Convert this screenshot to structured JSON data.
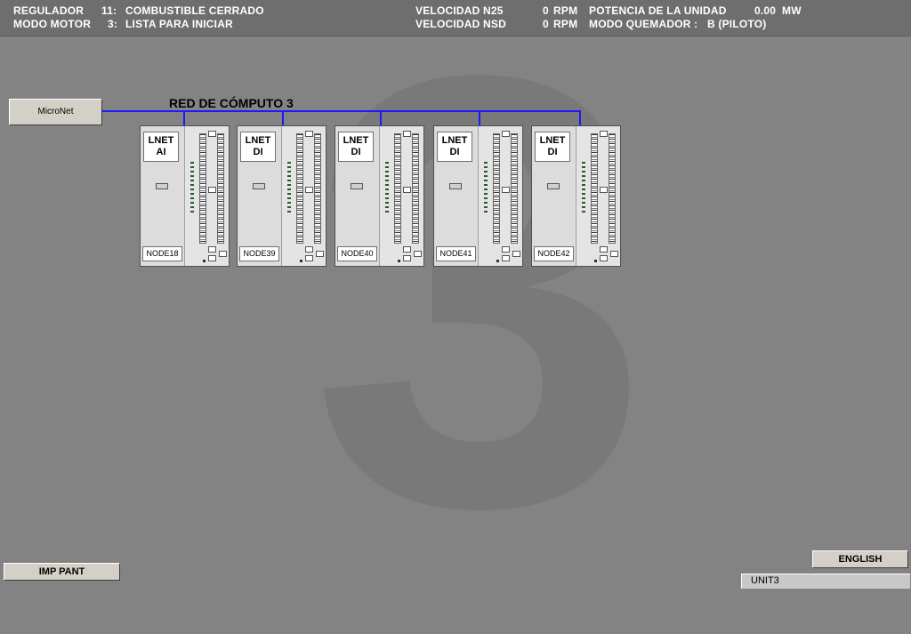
{
  "header": {
    "regulador_label": "REGULADOR",
    "regulador_code": "11:",
    "regulador_value": "COMBUSTIBLE CERRADO",
    "modo_motor_label": "MODO MOTOR",
    "modo_motor_code": "3:",
    "modo_motor_value": "LISTA PARA INICIAR",
    "vel_n25_label": "VELOCIDAD N25",
    "vel_n25_value": "0",
    "vel_n25_unit": "RPM",
    "vel_nsd_label": "VELOCIDAD NSD",
    "vel_nsd_value": "0",
    "vel_nsd_unit": "RPM",
    "potencia_label": "POTENCIA DE LA UNIDAD",
    "potencia_value": "0.00",
    "potencia_unit": "MW",
    "quemador_label": "MODO QUEMADOR :",
    "quemador_value": "B (PILOTO)"
  },
  "background_numeral": "3",
  "network": {
    "micronet_button": "MicroNet",
    "title": "RED DE CÓMPUTO 3",
    "bus_color": "#1a1aff",
    "modules": [
      {
        "label": "LNET\nAI",
        "node": "NODE18"
      },
      {
        "label": "LNET\nDI",
        "node": "NODE39"
      },
      {
        "label": "LNET\nDI",
        "node": "NODE40"
      },
      {
        "label": "LNET\nDI",
        "node": "NODE41"
      },
      {
        "label": "LNET\nDI",
        "node": "NODE42"
      }
    ]
  },
  "footer": {
    "print_button": "IMP PANT",
    "language_button": "ENGLISH",
    "unit": "UNIT3"
  }
}
